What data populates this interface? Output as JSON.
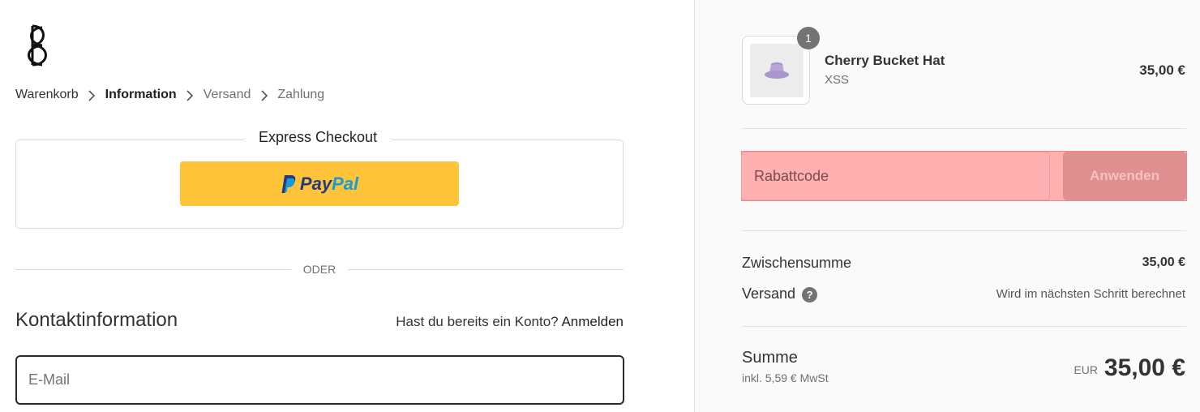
{
  "brand": {
    "logo_icon": "brand-monogram-icon"
  },
  "breadcrumb": {
    "items": [
      {
        "label": "Warenkorb"
      },
      {
        "label": "Information"
      },
      {
        "label": "Versand"
      },
      {
        "label": "Zahlung"
      }
    ],
    "separator_icon": "chevron-right-icon"
  },
  "express_checkout": {
    "title": "Express Checkout",
    "paypal": {
      "pay": "Pay",
      "pal": "Pal",
      "color_bg": "#ffc439"
    }
  },
  "divider_text": "ODER",
  "contact": {
    "title": "Kontaktinformation",
    "login_prompt": "Hast du bereits ein Konto?",
    "login_link": "Anmelden",
    "email_placeholder": "E-Mail"
  },
  "cart": {
    "item": {
      "quantity": "1",
      "name": "Cherry Bucket Hat",
      "variant": "XSS",
      "price": "35,00 €"
    },
    "discount": {
      "placeholder": "Rabattcode",
      "apply_label": "Anwenden"
    },
    "subtotal": {
      "label": "Zwischensumme",
      "value": "35,00 €"
    },
    "shipping": {
      "label": "Versand",
      "value": "Wird im nächsten Schritt berechnet"
    },
    "total": {
      "label": "Summe",
      "tax_note": "inkl. 5,59 € MwSt",
      "currency": "EUR",
      "value": "35,00 €"
    }
  }
}
